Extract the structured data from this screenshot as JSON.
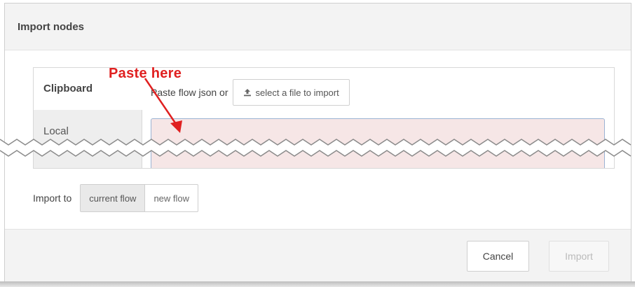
{
  "dialog": {
    "title": "Import nodes",
    "tabs": [
      {
        "label": "Clipboard",
        "active": true
      },
      {
        "label": "Local",
        "active": false
      }
    ],
    "paste_label": "Paste flow json or",
    "file_button": {
      "label": "select a file to import",
      "icon": "upload-icon"
    },
    "textarea_value": "",
    "annotation": {
      "text": "Paste here",
      "color": "#e02020"
    },
    "import_to": {
      "label": "Import to",
      "options": [
        "current flow",
        "new flow"
      ],
      "selected": "current flow"
    },
    "buttons": {
      "cancel": "Cancel",
      "import": "Import"
    }
  }
}
